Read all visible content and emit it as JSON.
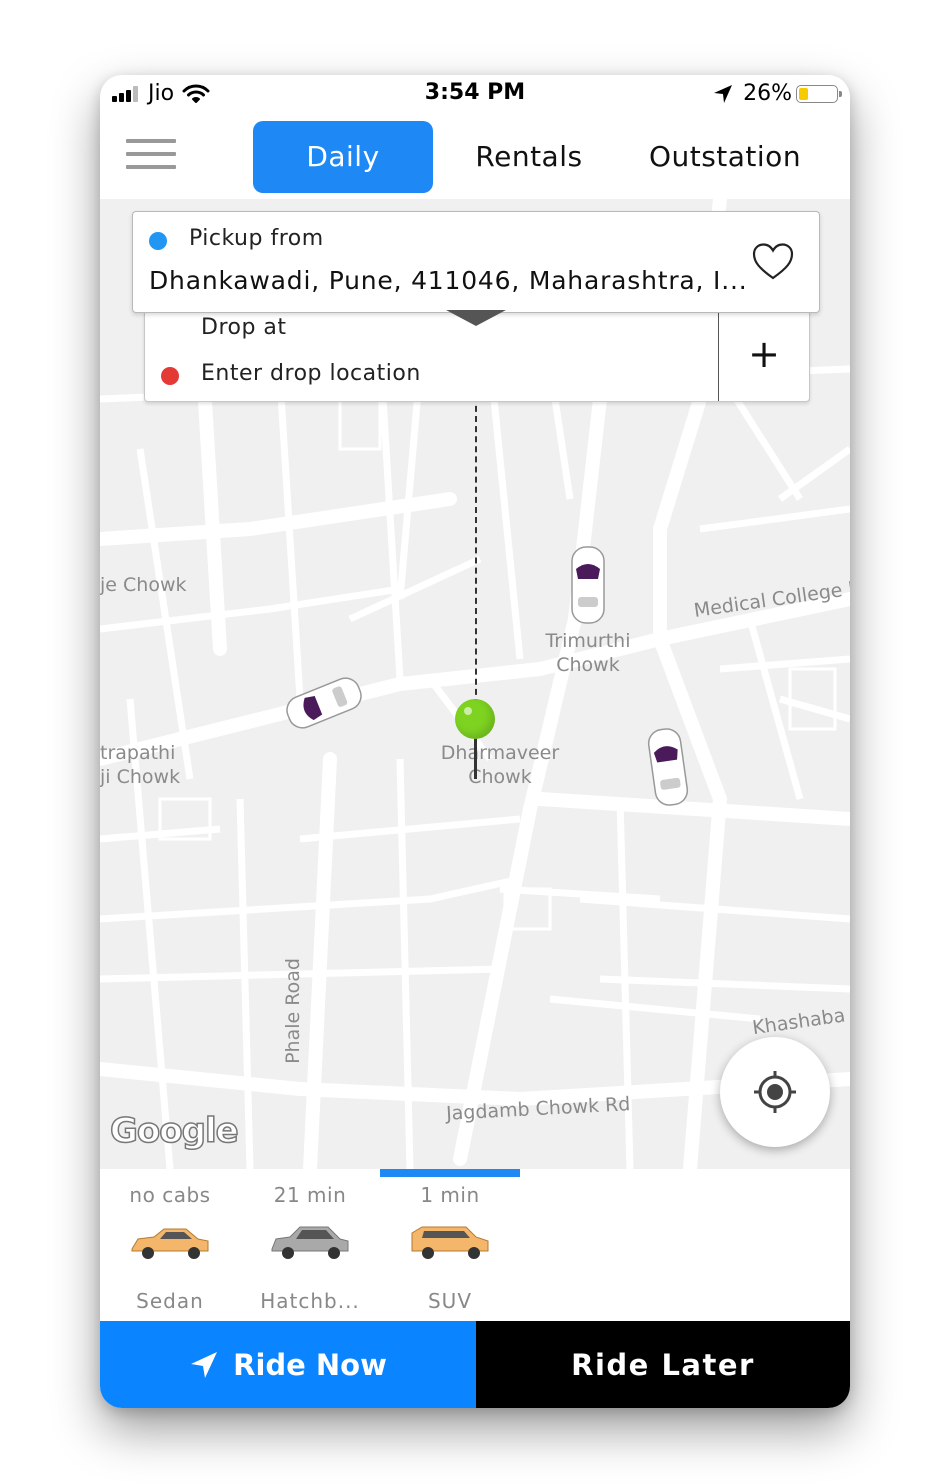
{
  "status_bar": {
    "carrier": "Jio",
    "time": "3:54 PM",
    "battery": "26%",
    "battery_level": 0.26
  },
  "tabs": [
    {
      "label": "Daily",
      "active": true
    },
    {
      "label": "Rentals",
      "active": false
    },
    {
      "label": "Outstation",
      "active": false
    }
  ],
  "pickup": {
    "label": "Pickup from",
    "address": "Dhankawadi, Pune, 411046, Maharashtra, I..."
  },
  "drop": {
    "label": "Drop at",
    "placeholder": "Enter drop location",
    "add_symbol": "+"
  },
  "map": {
    "labels": {
      "raje_chowk": "je Chowk",
      "chhatrapati_line1": "trapathi",
      "chhatrapati_line2": "ji Chowk",
      "trimurthi_line1": "Trimurthi",
      "trimurthi_line2": "Chowk",
      "medical_college": "Medical College R",
      "dharmaveer_line1": "Dharmaveer",
      "dharmaveer_line2": "Chowk",
      "phale_road": "Phale Road",
      "khashaba": "Khashaba J",
      "jagdamb": "Jagdamb Chowk Rd"
    },
    "attribution": "Google",
    "colors": {
      "pin": "#7ed321",
      "pickup_dot": "#2196f3",
      "drop_dot": "#e53935"
    }
  },
  "cab_options": [
    {
      "eta": "no cabs",
      "name": "Sedan",
      "selected": false,
      "color": "#f4b66a"
    },
    {
      "eta": "21 min",
      "name": "Hatchb...",
      "selected": false,
      "color": "#a9a9a9"
    },
    {
      "eta": "1 min",
      "name": "SUV",
      "selected": true,
      "color": "#f4b66a"
    }
  ],
  "actions": {
    "ride_now": "Ride Now",
    "ride_later": "Ride Later"
  },
  "colors": {
    "accent": "#1e88f5",
    "ride_now_bg": "#0a84ff",
    "ride_later_bg": "#000000"
  }
}
